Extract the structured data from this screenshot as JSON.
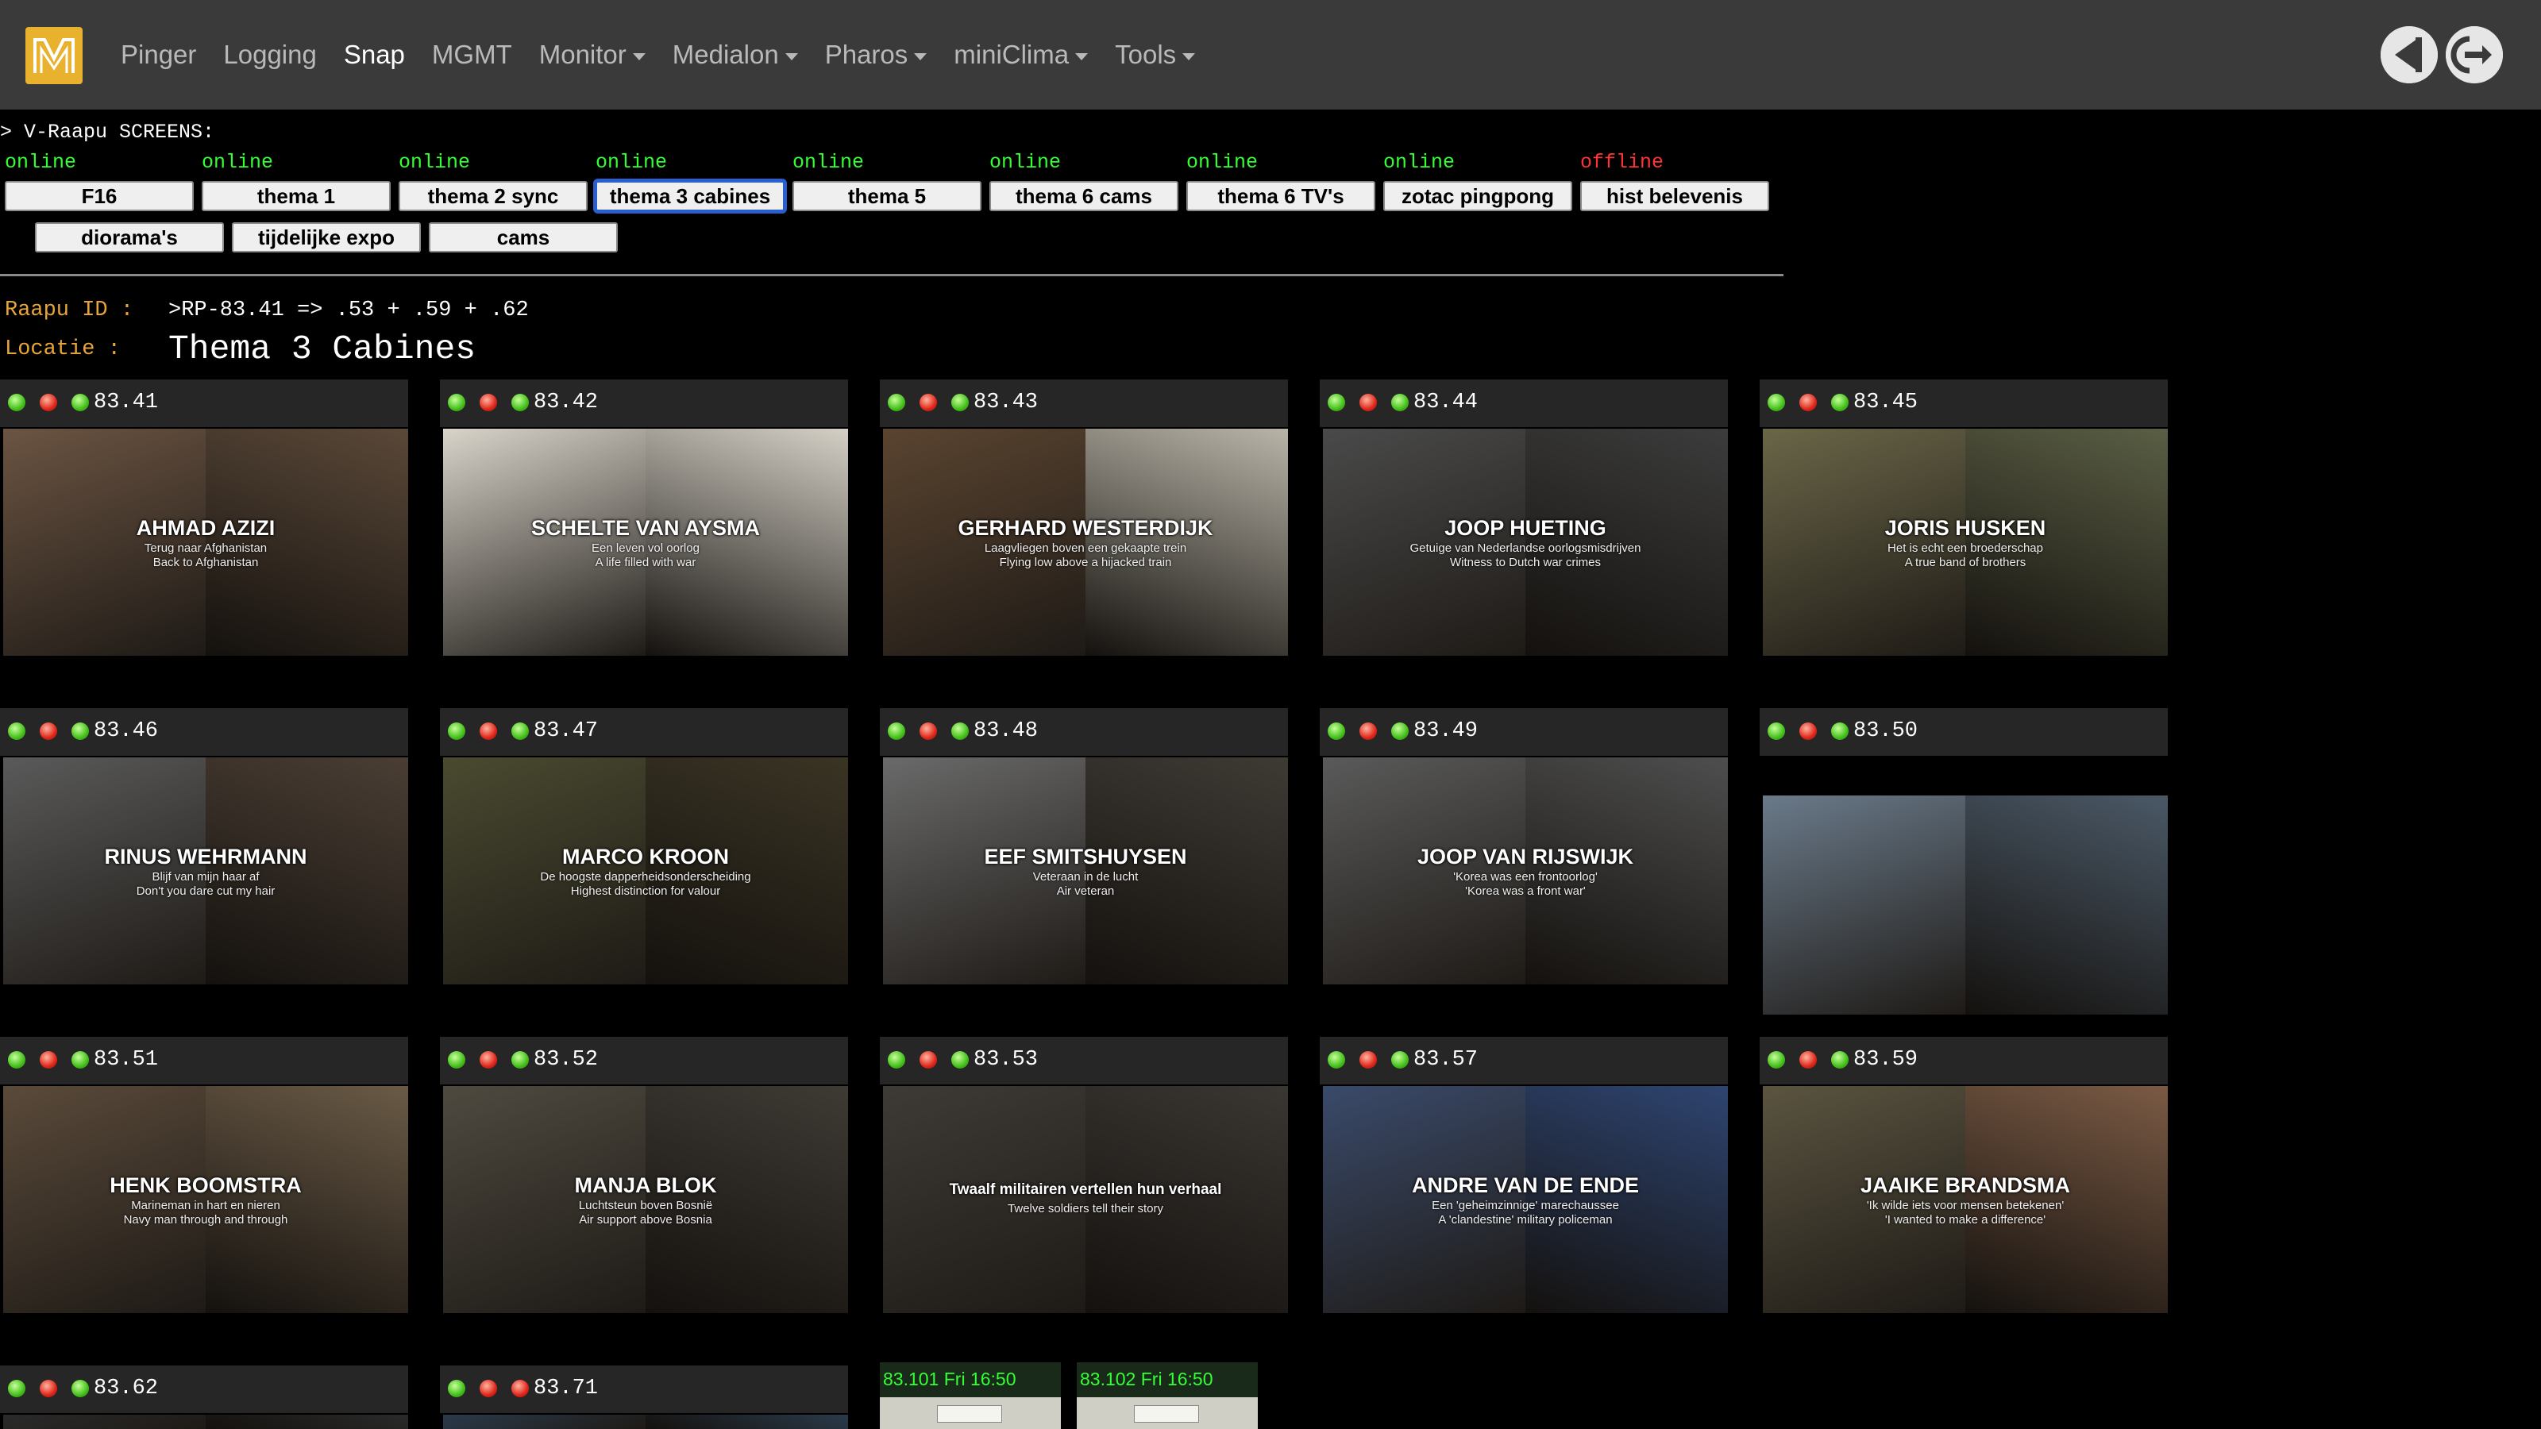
{
  "nav": {
    "items": [
      {
        "label": "Pinger",
        "dropdown": false,
        "active": false
      },
      {
        "label": "Logging",
        "dropdown": false,
        "active": false
      },
      {
        "label": "Snap",
        "dropdown": false,
        "active": true
      },
      {
        "label": "MGMT",
        "dropdown": false,
        "active": false
      },
      {
        "label": "Monitor",
        "dropdown": true,
        "active": false
      },
      {
        "label": "Medialon",
        "dropdown": true,
        "active": false
      },
      {
        "label": "Pharos",
        "dropdown": true,
        "active": false
      },
      {
        "label": "miniClima",
        "dropdown": true,
        "active": false
      },
      {
        "label": "Tools",
        "dropdown": true,
        "active": false
      }
    ]
  },
  "screens": {
    "title": "> V-Raapu SCREENS:",
    "row1": [
      {
        "status": "online",
        "label": "F16"
      },
      {
        "status": "online",
        "label": "thema 1"
      },
      {
        "status": "online",
        "label": "thema 2 sync"
      },
      {
        "status": "online",
        "label": "thema 3 cabines",
        "selected": true
      },
      {
        "status": "online",
        "label": "thema 5"
      },
      {
        "status": "online",
        "label": "thema 6 cams"
      },
      {
        "status": "online",
        "label": "thema 6 TV's"
      },
      {
        "status": "online",
        "label": "zotac pingpong"
      },
      {
        "status": "offline",
        "label": "hist belevenis"
      }
    ],
    "row2": [
      {
        "label": "diorama's"
      },
      {
        "label": "tijdelijke expo"
      },
      {
        "label": "cams"
      }
    ]
  },
  "info": {
    "raapu_label": "Raapu ID :",
    "raapu_value": ">RP-83.41 => .53 + .59 + .62",
    "locatie_label": "Locatie :",
    "locatie_value": "Thema 3 Cabines"
  },
  "tiles": [
    {
      "id": "83.41",
      "name": "AHMAD AZIZI",
      "sub1": "Terug naar Afghanistan",
      "sub2": "Back to Afghanistan",
      "colors": [
        "#6b5442",
        "#5a4838"
      ]
    },
    {
      "id": "83.42",
      "name": "SCHELTE VAN AYSMA",
      "sub1": "Een leven vol oorlog",
      "sub2": "A life filled with war",
      "colors": [
        "#d8d4ca",
        "#d4d0c6"
      ]
    },
    {
      "id": "83.43",
      "name": "GERHARD WESTERDIJK",
      "sub1": "Laagvliegen boven een gekaapte trein",
      "sub2": "Flying low above a hijacked train",
      "colors": [
        "#5a4430",
        "#b8b4a8"
      ]
    },
    {
      "id": "83.44",
      "name": "JOOP HUETING",
      "sub1": "Getuige van Nederlandse oorlogsmisdrijven",
      "sub2": "Witness to Dutch war crimes",
      "colors": [
        "#4a4a4a",
        "#3c3c3c"
      ]
    },
    {
      "id": "83.45",
      "name": "JORIS HUSKEN",
      "sub1": "Het is echt een broederschap",
      "sub2": "A true band of brothers",
      "colors": [
        "#6a6648",
        "#5a5e44"
      ]
    },
    {
      "id": "83.46",
      "name": "RINUS WEHRMANN",
      "sub1": "Blijf van mijn haar af",
      "sub2": "Don't you dare cut my hair",
      "colors": [
        "#5a5a5a",
        "#4a3e34"
      ]
    },
    {
      "id": "83.47",
      "name": "MARCO KROON",
      "sub1": "De hoogste dapperheidsonderscheiding",
      "sub2": "Highest distinction for valour",
      "colors": [
        "#4a4a30",
        "#3a3424"
      ]
    },
    {
      "id": "83.48",
      "name": "EEF SMITSHUYSEN",
      "sub1": "Veteraan in de lucht",
      "sub2": "Air veteran",
      "colors": [
        "#6a6a6a",
        "#3e3a34"
      ]
    },
    {
      "id": "83.49",
      "name": "JOOP VAN RIJSWIJK",
      "sub1": "'Korea was een frontoorlog'",
      "sub2": "'Korea was a front war'",
      "colors": [
        "#5a5a5a",
        "#4e4e4e"
      ]
    },
    {
      "id": "83.50",
      "name": "",
      "sub1": "",
      "sub2": "",
      "colors": [
        "#6a7a8a",
        "#4a5866"
      ]
    },
    {
      "id": "83.51",
      "name": "HENK BOOMSTRA",
      "sub1": "Marineman in hart en nieren",
      "sub2": "Navy man through and through",
      "colors": [
        "#5a4a3a",
        "#6a5a46"
      ]
    },
    {
      "id": "83.52",
      "name": "MANJA BLOK",
      "sub1": "Luchtsteun boven Bosnië",
      "sub2": "Air support above Bosnia",
      "colors": [
        "#4e4a40",
        "#3e3a34"
      ]
    },
    {
      "id": "83.53",
      "name": "Twaalf militairen vertellen hun verhaal",
      "sub1": "Twelve soldiers tell their story",
      "sub2": "",
      "colors": [
        "#3e3a36",
        "#3a3632"
      ]
    },
    {
      "id": "83.57",
      "name": "ANDRE VAN DE ENDE",
      "sub1": "Een 'geheimzinnige' marechaussee",
      "sub2": "A 'clandestine' military policeman",
      "colors": [
        "#3a4a6a",
        "#2e4470"
      ]
    },
    {
      "id": "83.59",
      "name": "JAAIKE BRANDSMA",
      "sub1": "'Ik wilde iets voor mensen betekenen'",
      "sub2": "'I wanted to make a difference'",
      "colors": [
        "#5a5440",
        "#7a5a44"
      ]
    },
    {
      "id": "83.62",
      "name": "",
      "sub1": "",
      "sub2": "",
      "colors": [
        "#2a2a2a",
        "#2a2a2a"
      ]
    },
    {
      "id": "83.71",
      "name": "",
      "sub1": "",
      "sub2": "",
      "colors": [
        "#2a3a4a",
        "#2a3a4a"
      ]
    }
  ],
  "snaps": [
    {
      "label": "83.101 Fri 16:50"
    },
    {
      "label": "83.102 Fri 16:50"
    }
  ],
  "colors": {
    "online": "#33ff33",
    "offline": "#ff3333",
    "label": "#e8a63a",
    "navbar": "#3a3a3a",
    "logo": "#e8b22e"
  }
}
